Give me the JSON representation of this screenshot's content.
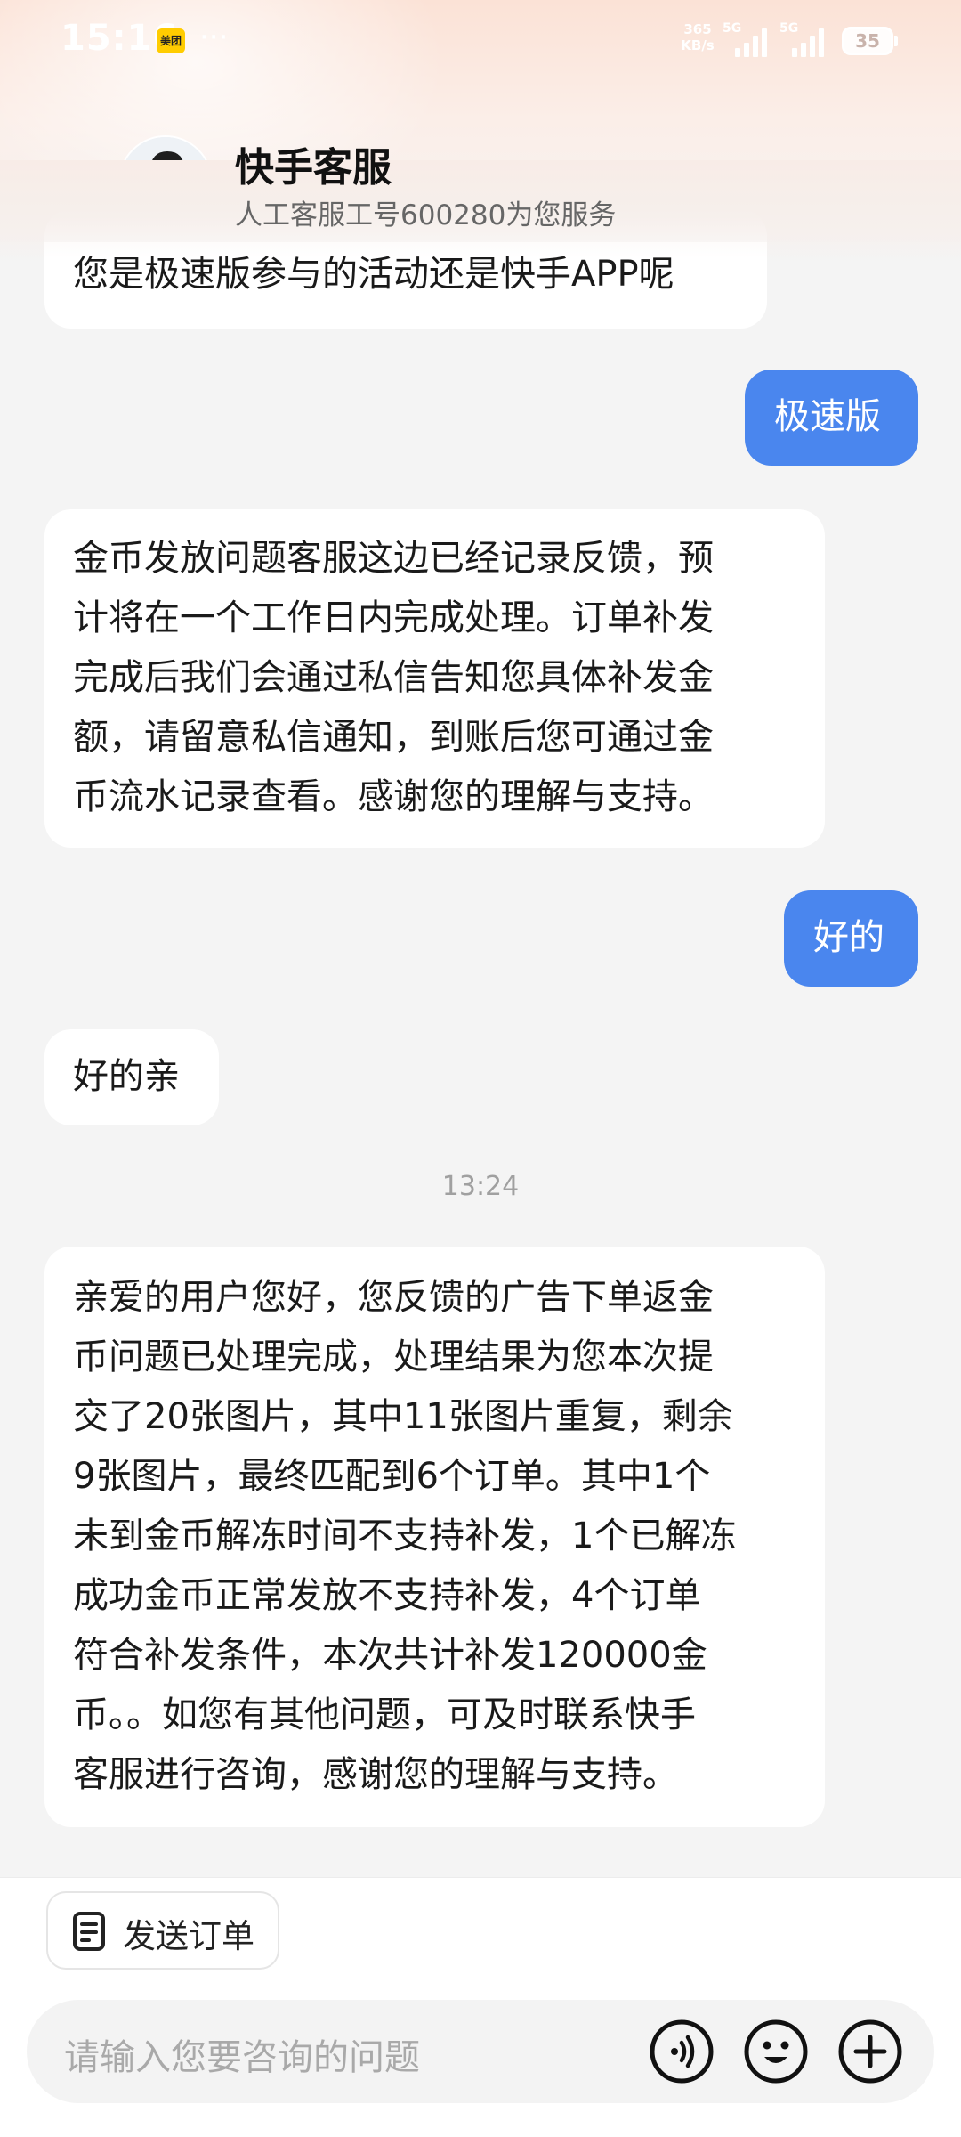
{
  "status_bar": {
    "time": "15:16",
    "app_badge": "美团",
    "more": "···",
    "net_speed_value": "365",
    "net_speed_unit": "KB/s",
    "signal1_label": "5G",
    "signal2_label": "5G",
    "battery": "35"
  },
  "header": {
    "title": "快手客服",
    "subtitle": "人工客服工号600280为您服务"
  },
  "messages": [
    {
      "side": "left",
      "text": "您是极速版参与的活动还是快手APP呢"
    },
    {
      "side": "right",
      "text": "极速版"
    },
    {
      "side": "left",
      "text": "金币发放问题客服这边已经记录反馈，预\n计将在一个工作日内完成处理。订单补发\n完成后我们会通过私信告知您具体补发金\n额，请留意私信通知，到账后您可通过金\n币流水记录查看。感谢您的理解与支持。"
    },
    {
      "side": "right",
      "text": "好的"
    },
    {
      "side": "left",
      "text": "好的亲"
    },
    {
      "side": "left",
      "text": "亲爱的用户您好，您反馈的广告下单返金\n币问题已处理完成，处理结果为您本次提\n交了20张图片，其中11张图片重复，剩余\n9张图片，最终匹配到6个订单。其中1个\n未到金币解冻时间不支持补发，1个已解冻\n成功金币正常发放不支持补发，4个订单\n符合补发条件，本次共计补发120000金\n币。。如您有其他问题，可及时联系快手\n客服进行咨询，感谢您的理解与支持。"
    }
  ],
  "timestamp": "13:24",
  "bottom": {
    "send_order_label": "发送订单",
    "input_placeholder": "请输入您要咨询的问题"
  },
  "colors": {
    "accent": "#4a86ee",
    "header_tint": "#fbe2d6"
  }
}
